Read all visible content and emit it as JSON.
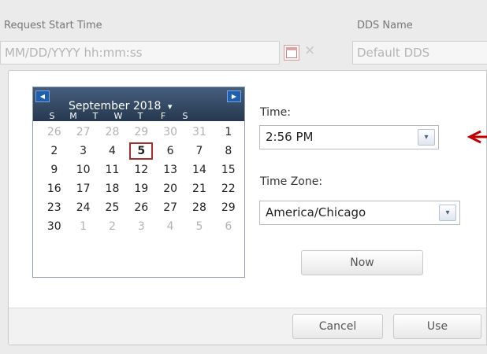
{
  "form": {
    "request_start_label": "Request Start Time",
    "request_start_placeholder": "MM/DD/YYYY hh:mm:ss",
    "dds_name_label": "DDS Name",
    "dds_name_placeholder": "Default DDS",
    "clear_glyph": "×"
  },
  "calendar": {
    "month_label": "September 2018",
    "month_dropdown_glyph": "▾",
    "prev_glyph": "◀",
    "next_glyph": "▶",
    "weekdays": [
      "S",
      "M",
      "T",
      "W",
      "T",
      "F",
      "S"
    ],
    "weeks": [
      [
        "26",
        "27",
        "28",
        "29",
        "30",
        "31",
        "1"
      ],
      [
        "2",
        "3",
        "4",
        "5",
        "6",
        "7",
        "8"
      ],
      [
        "9",
        "10",
        "11",
        "12",
        "13",
        "14",
        "15"
      ],
      [
        "16",
        "17",
        "18",
        "19",
        "20",
        "21",
        "22"
      ],
      [
        "23",
        "24",
        "25",
        "26",
        "27",
        "28",
        "29"
      ],
      [
        "30",
        "1",
        "2",
        "3",
        "4",
        "5",
        "6"
      ]
    ],
    "first_week_other_count": 6,
    "last_week_current_count": 1,
    "selected_day": "5"
  },
  "time": {
    "label": "Time:",
    "value": "2:56 PM",
    "dropdown_glyph": "▾"
  },
  "timezone": {
    "label": "Time Zone:",
    "value": "America/Chicago",
    "dropdown_glyph": "▾"
  },
  "buttons": {
    "now": "Now",
    "cancel": "Cancel",
    "use": "Use"
  },
  "colors": {
    "calendar_header": "#26384f",
    "nav_button": "#1e5fb0",
    "selected_border": "#a23030",
    "annotation_arrow": "#c00000"
  }
}
